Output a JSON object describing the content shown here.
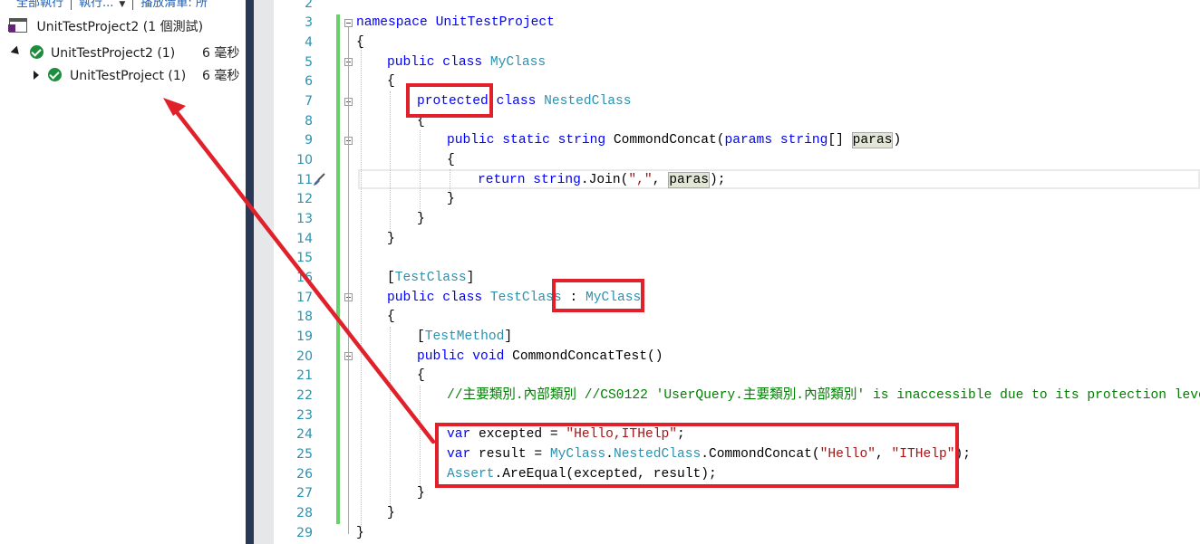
{
  "explorer": {
    "toolbar": {
      "run_all": "全部執行",
      "run": "執行...",
      "playlist": "播放清單: 所"
    },
    "summary": "UnitTestProject2 (1 個測試)",
    "tree": [
      {
        "label": "UnitTestProject2 (1)",
        "duration": "6 毫秒",
        "status": "passed",
        "expanded": true
      },
      {
        "label": "UnitTestProject (1)",
        "duration": "6 毫秒",
        "status": "passed",
        "expanded": false
      }
    ]
  },
  "editor": {
    "lines": [
      "2",
      "3",
      "4",
      "5",
      "6",
      "7",
      "8",
      "9",
      "10",
      "11",
      "12",
      "13",
      "14",
      "15",
      "16",
      "17",
      "18",
      "19",
      "20",
      "21",
      "22",
      "23",
      "24",
      "25",
      "26",
      "27",
      "28",
      "29"
    ],
    "code": {
      "l3": "namespace UnitTestProject",
      "l4": "{",
      "l5a": "public class ",
      "l5b": "MyClass",
      "l6": "{",
      "l7a": "protected",
      "l7b": " class ",
      "l7c": "NestedClass",
      "l8": "{",
      "l9a": "public static string ",
      "l9b": "CommondConcat(",
      "l9c": "params string",
      "l9d": "[] ",
      "l9e": "paras",
      "l9f": ")",
      "l10": "{",
      "l11a": "return string",
      "l11b": ".Join(",
      "l11c": "\",\"",
      "l11d": ", ",
      "l11e": "paras",
      "l11f": ");",
      "l12": "}",
      "l13": "}",
      "l14": "}",
      "l16a": "[",
      "l16b": "TestClass",
      "l16c": "]",
      "l17a": "public class ",
      "l17b": "TestClass",
      "l17c": " : ",
      "l17d": "MyClass",
      "l18": "{",
      "l19a": "[",
      "l19b": "TestMethod",
      "l19c": "]",
      "l20a": "public void ",
      "l20b": "CommondConcatTest()",
      "l21": "{",
      "l22": "//主要類別.內部類別 //CS0122 'UserQuery.主要類別.內部類別' is inaccessible due to its protection leve",
      "l24a": "var",
      "l24b": " excepted = ",
      "l24c": "\"Hello,ITHelp\"",
      "l24d": ";",
      "l25a": "var",
      "l25b": " result = ",
      "l25c": "MyClass",
      "l25d": ".",
      "l25e": "NestedClass",
      "l25f": ".CommondConcat(",
      "l25g": "\"Hello\"",
      "l25h": ", ",
      "l25i": "\"ITHelp\"",
      "l25j": ");",
      "l26a": "Assert",
      "l26b": ".AreEqual(excepted, result);",
      "l27": "}",
      "l28": "}",
      "l29": "}"
    }
  },
  "colors": {
    "keyword": "#0000ff",
    "type": "#2b91af",
    "string": "#a31515",
    "comment": "#008000",
    "annotation": "#e0202a",
    "pass": "#1e8e3e"
  }
}
